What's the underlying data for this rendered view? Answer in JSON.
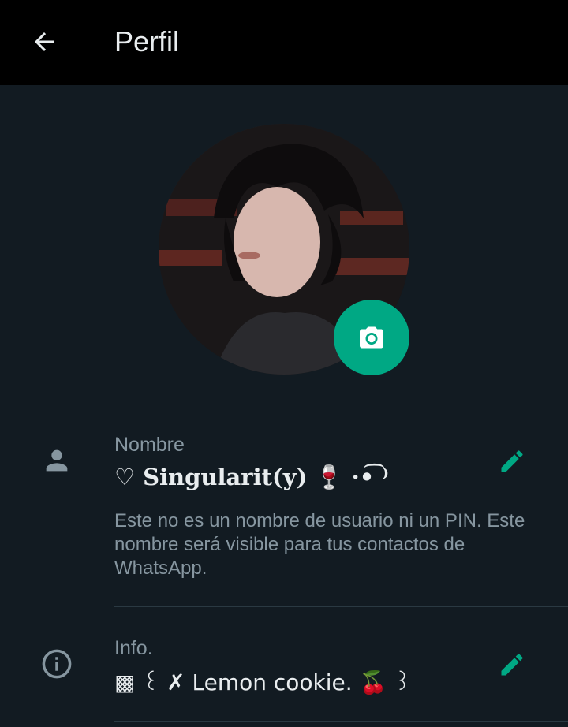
{
  "header": {
    "title": "Perfil"
  },
  "profile_photo": {
    "alt": "profile photo"
  },
  "fields": {
    "name": {
      "label": "Nombre",
      "value": "♡ 𝐒𝐢𝐧𝐠𝐮𝐥𝐚𝐫𝐢𝐭(𝐲) 🍷 ·•͡ ⁾",
      "helper": "Este no es un nombre de usuario ni un PIN. Este nombre será visible para tus contactos de WhatsApp."
    },
    "info": {
      "label": "Info.",
      "value": "▩ ꒰ ✗ Lemon cookie. 🍒 ꒱"
    }
  },
  "colors": {
    "background": "#121b22",
    "appbar": "#000000",
    "accent": "#00a884",
    "primary_text": "#e9edef",
    "secondary_text": "#8696a0"
  },
  "icons": {
    "back": "arrow-left-icon",
    "camera": "camera-icon",
    "person": "person-icon",
    "info": "info-icon",
    "edit": "pencil-icon"
  }
}
